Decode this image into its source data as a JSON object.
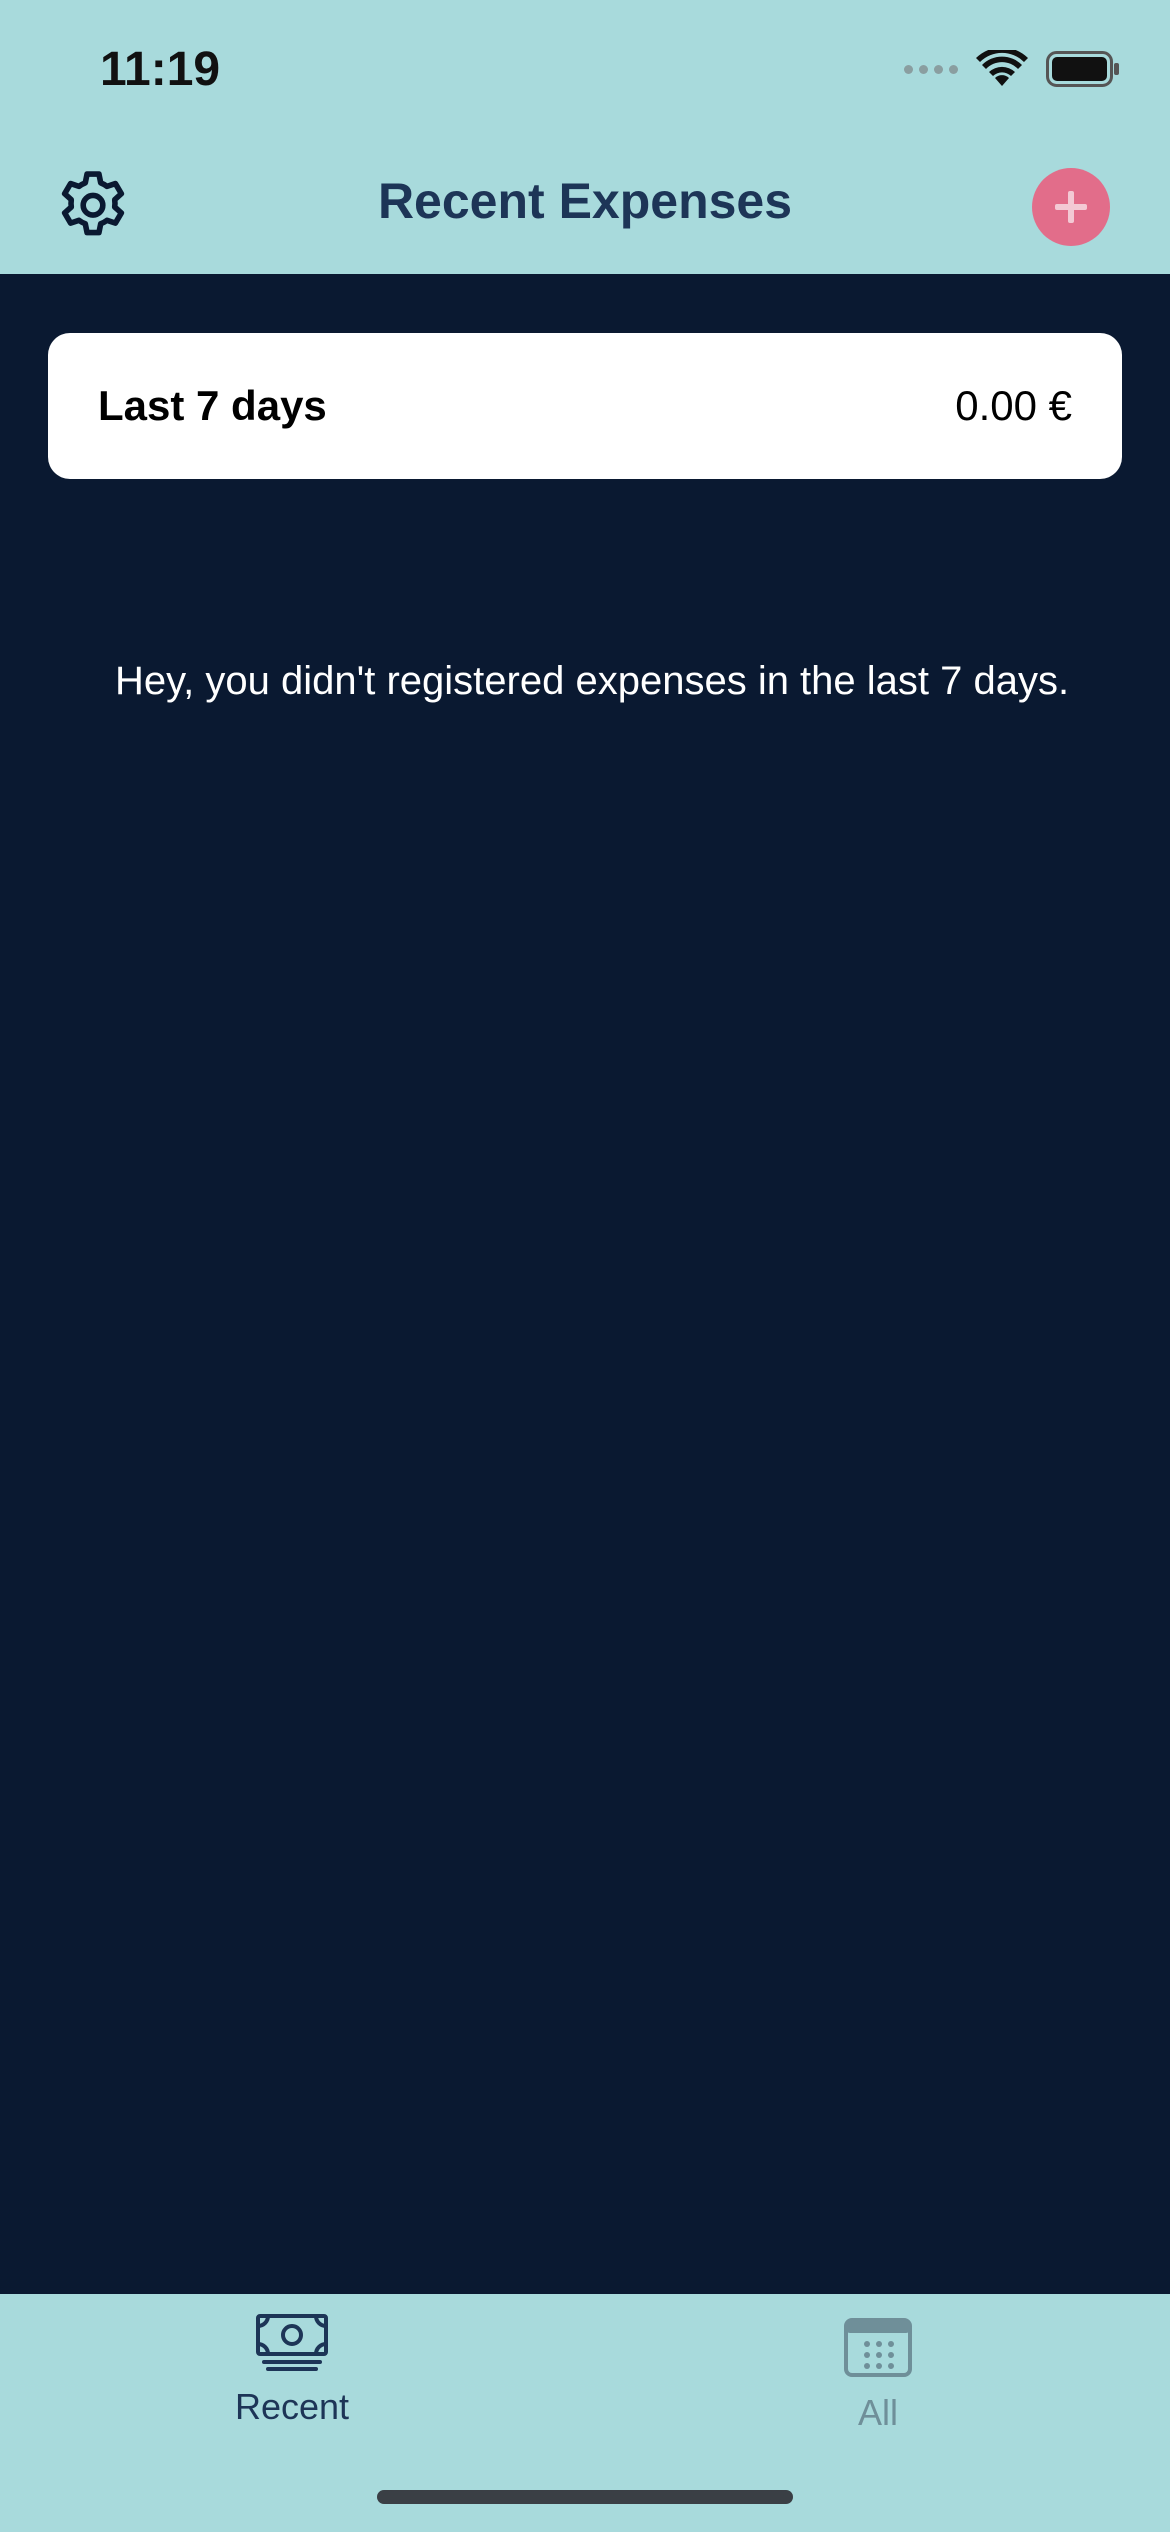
{
  "status_bar": {
    "time": "11:19"
  },
  "header": {
    "title": "Recent Expenses",
    "settings_icon": "gear-icon",
    "add_icon": "plus-icon"
  },
  "summary": {
    "label": "Last 7 days",
    "value": "0.00 €"
  },
  "empty_state": {
    "message": "Hey, you didn't registered expenses in the last 7 days."
  },
  "tabbar": {
    "tabs": [
      {
        "label": "Recent",
        "icon": "money-bill-icon",
        "active": true
      },
      {
        "label": "All",
        "icon": "calendar-icon",
        "active": false
      }
    ]
  },
  "colors": {
    "header_bg": "#a8dadc",
    "body_bg": "#0a1931",
    "title": "#1d3557",
    "accent": "#e26d8a"
  }
}
